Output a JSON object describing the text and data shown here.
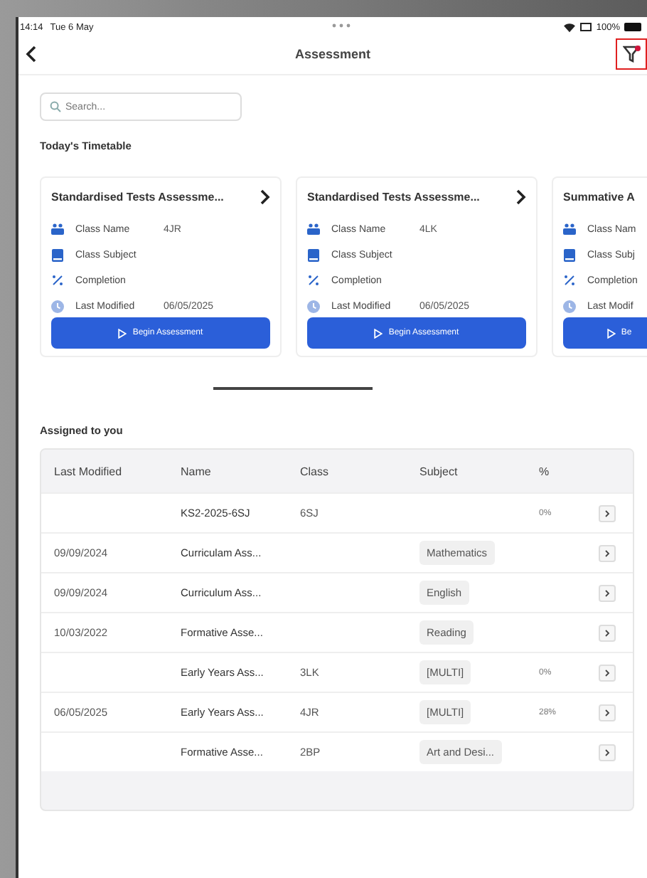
{
  "status_bar": {
    "time": "14:14",
    "date": "Tue 6 May",
    "battery": "100%"
  },
  "nav": {
    "title": "Assessment",
    "filter_active": true,
    "highlighted": true
  },
  "search": {
    "placeholder": "Search..."
  },
  "timetable": {
    "heading": "Today's Timetable",
    "cards": [
      {
        "title": "Standardised Tests Assessme...",
        "fields": [
          {
            "kind": "class",
            "label": "Class Name",
            "value": "4JR"
          },
          {
            "kind": "subject",
            "label": "Class Subject"
          },
          {
            "kind": "completion",
            "label": "Completion"
          },
          {
            "kind": "modified",
            "label": "Last Modified",
            "value": "06/05/2025"
          }
        ],
        "button": "Begin Assessment"
      },
      {
        "title": "Standardised Tests Assessme...",
        "fields": [
          {
            "kind": "class",
            "label": "Class Name",
            "value": "4LK"
          },
          {
            "kind": "subject",
            "label": "Class Subject"
          },
          {
            "kind": "completion",
            "label": "Completion"
          },
          {
            "kind": "modified",
            "label": "Last Modified",
            "value": "06/05/2025"
          }
        ],
        "button": "Begin Assessment"
      },
      {
        "title": "Summative A",
        "fields": [
          {
            "kind": "class",
            "label": "Class Nam"
          },
          {
            "kind": "subject",
            "label": "Class Subj"
          },
          {
            "kind": "completion",
            "label": "Completion"
          },
          {
            "kind": "modified",
            "label": "Last Modif"
          }
        ],
        "button": "Be"
      }
    ]
  },
  "assigned": {
    "heading": "Assigned to you",
    "columns": [
      "Last Modified",
      "Name",
      "Class",
      "Subject",
      "%"
    ],
    "rows": [
      {
        "modified": "",
        "name": "KS2-2025-6SJ",
        "class": "6SJ",
        "subject": "",
        "percent": "0%"
      },
      {
        "modified": "09/09/2024",
        "name": "Curriculam Ass...",
        "class": "",
        "subject": "Mathematics",
        "percent": ""
      },
      {
        "modified": "09/09/2024",
        "name": "Curriculum Ass...",
        "class": "",
        "subject": "English",
        "percent": ""
      },
      {
        "modified": "10/03/2022",
        "name": "Formative Asse...",
        "class": "",
        "subject": "Reading",
        "percent": ""
      },
      {
        "modified": "",
        "name": "Early Years Ass...",
        "class": "3LK",
        "subject": "[MULTI]",
        "percent": "0%"
      },
      {
        "modified": "06/05/2025",
        "name": "Early Years Ass...",
        "class": "4JR",
        "subject": "[MULTI]",
        "percent": "28%"
      },
      {
        "modified": "",
        "name": "Formative Asse...",
        "class": "2BP",
        "subject": "Art and Desi...",
        "percent": ""
      }
    ]
  }
}
